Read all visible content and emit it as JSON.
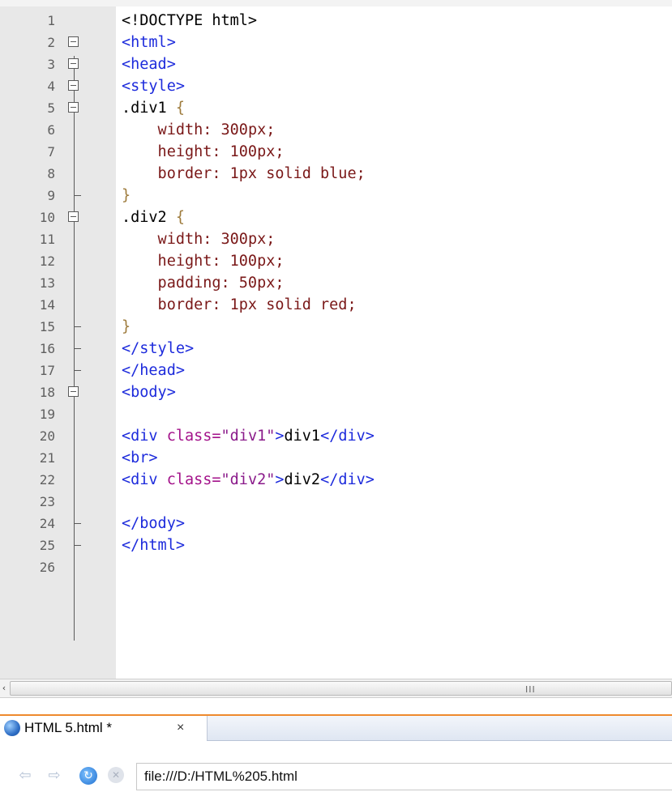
{
  "editor": {
    "lines": [
      {
        "n": "1"
      },
      {
        "n": "2"
      },
      {
        "n": "3"
      },
      {
        "n": "4"
      },
      {
        "n": "5"
      },
      {
        "n": "6"
      },
      {
        "n": "7"
      },
      {
        "n": "8"
      },
      {
        "n": "9"
      },
      {
        "n": "10"
      },
      {
        "n": "11"
      },
      {
        "n": "12"
      },
      {
        "n": "13"
      },
      {
        "n": "14"
      },
      {
        "n": "15"
      },
      {
        "n": "16"
      },
      {
        "n": "17"
      },
      {
        "n": "18"
      },
      {
        "n": "19"
      },
      {
        "n": "20"
      },
      {
        "n": "21"
      },
      {
        "n": "22"
      },
      {
        "n": "23"
      },
      {
        "n": "24"
      },
      {
        "n": "25"
      },
      {
        "n": "26"
      }
    ],
    "code": {
      "l1": "<!DOCTYPE html>",
      "l2": "<html>",
      "l3": "<head>",
      "l4": "<style>",
      "l5_sel": ".div1 ",
      "l5_brace": "{",
      "l6_prop": "    width: ",
      "l6_val": "300px;",
      "l7_prop": "    height: ",
      "l7_val": "100px;",
      "l8_prop": "    border: ",
      "l8_val": "1px solid blue;",
      "l9": "}",
      "l10_sel": ".div2 ",
      "l10_brace": "{",
      "l11_prop": "    width: ",
      "l11_val": "300px;",
      "l12_prop": "    height: ",
      "l12_val": "100px;",
      "l13_prop": "    padding: ",
      "l13_val": "50px;",
      "l14_prop": "    border: ",
      "l14_val": "1px solid red;",
      "l15": "}",
      "l16": "</style>",
      "l17": "</head>",
      "l18": "<body>",
      "l20_open": "<div ",
      "l20_attr": "class=",
      "l20_str": "\"div1\"",
      "l20_close": ">",
      "l20_text": "div1",
      "l20_end": "</div>",
      "l21": "<br>",
      "l22_open": "<div ",
      "l22_attr": "class=",
      "l22_str": "\"div2\"",
      "l22_close": ">",
      "l22_text": "div2",
      "l22_end": "</div>",
      "l24": "</body>",
      "l25": "</html>"
    }
  },
  "scrollbar": {
    "left_arrow": "‹",
    "grip": "III"
  },
  "tab": {
    "label": "HTML 5.html *",
    "close": "×"
  },
  "addressbar": {
    "back": "⇦",
    "forward": "⇨",
    "reload": "↻",
    "stop": "✕",
    "url": "file:///D:/HTML%205.html"
  },
  "colors": {
    "tag": "#1d2bdc",
    "property": "#7a1818",
    "tab_accent": "#ee8a2d"
  }
}
